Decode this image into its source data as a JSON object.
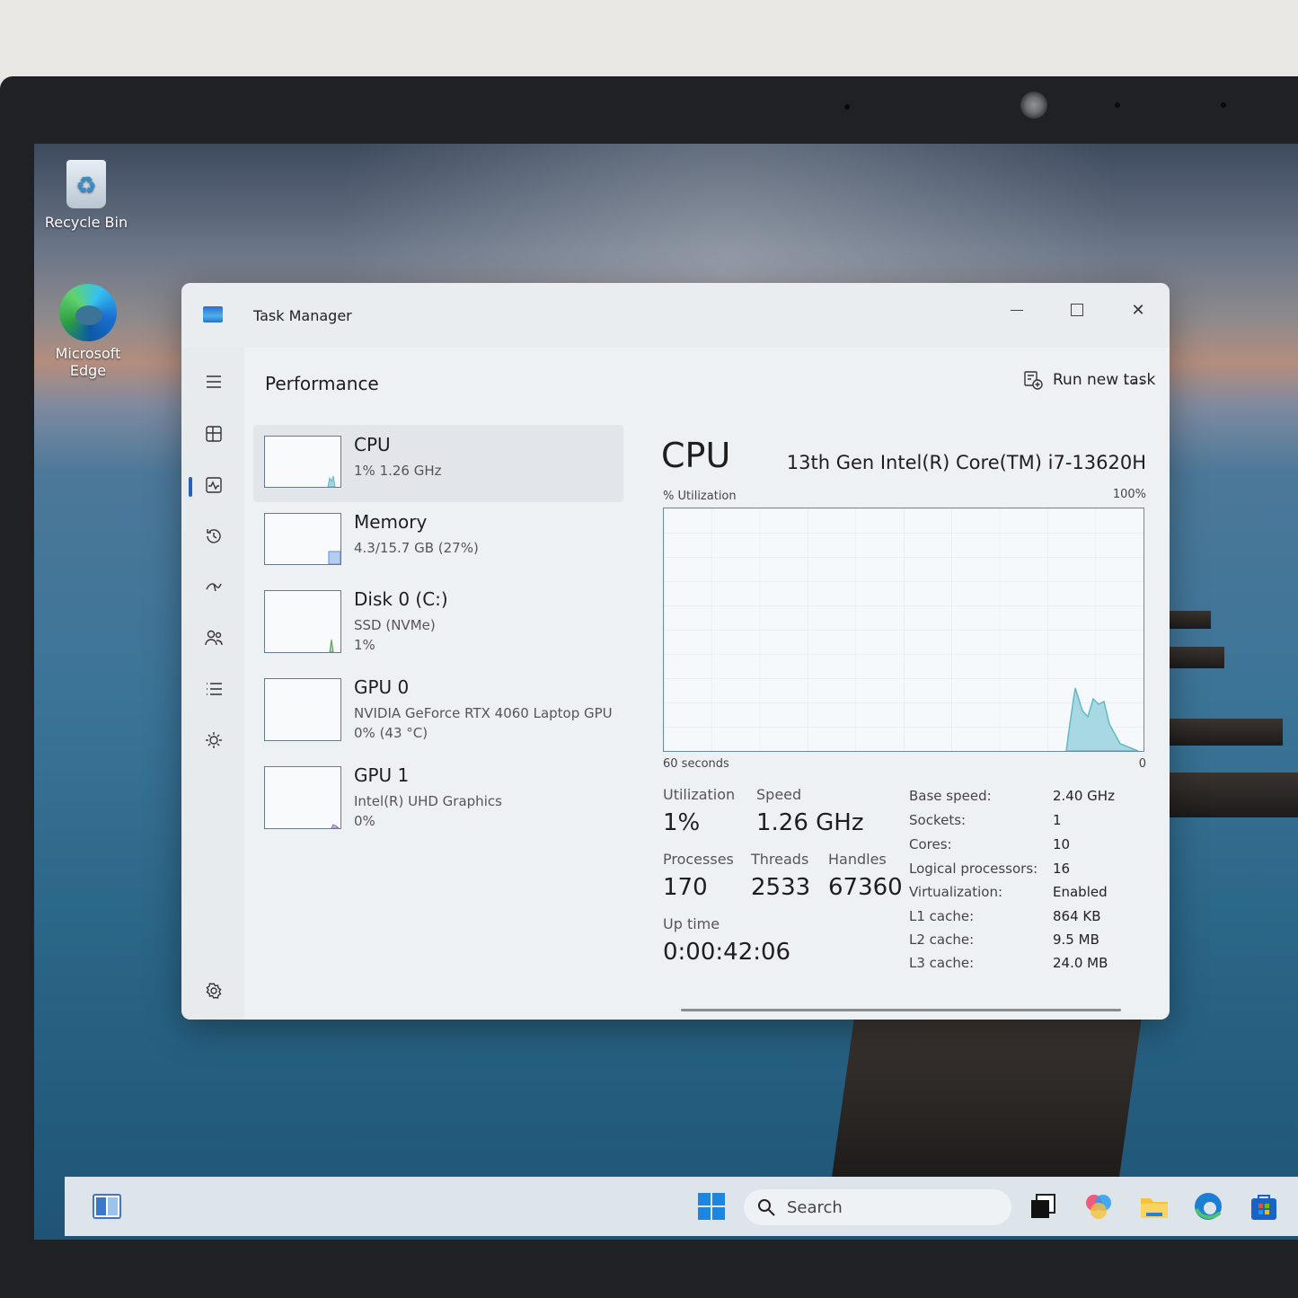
{
  "desktop": {
    "icons": [
      {
        "label": "Recycle Bin"
      },
      {
        "label_line1": "Microsoft",
        "label_line2": "Edge"
      }
    ]
  },
  "window": {
    "title": "Task Manager"
  },
  "command_bar": {
    "page_title": "Performance",
    "run_new_task": "Run new task",
    "more": "..."
  },
  "nav": {
    "items": [
      "hamburger-menu",
      "processes",
      "performance",
      "app-history",
      "startup-apps",
      "users",
      "details",
      "services",
      "settings"
    ],
    "active": "performance"
  },
  "perf_list": [
    {
      "name": "CPU",
      "line1": "1%  1.26 GHz",
      "line2": ""
    },
    {
      "name": "Memory",
      "line1": "4.3/15.7 GB (27%)",
      "line2": ""
    },
    {
      "name": "Disk 0 (C:)",
      "line1": "SSD (NVMe)",
      "line2": "1%"
    },
    {
      "name": "GPU 0",
      "line1": "NVIDIA GeForce RTX 4060 Laptop GPU",
      "line2": "0%  (43 °C)"
    },
    {
      "name": "GPU 1",
      "line1": "Intel(R) UHD Graphics",
      "line2": "0%"
    }
  ],
  "detail": {
    "title": "CPU",
    "model": "13th Gen Intel(R) Core(TM) i7-13620H",
    "y_axis_label": "% Utilization",
    "y_axis_max": "100%",
    "x_axis_label": "60 seconds",
    "x_axis_min": "0",
    "stats": {
      "utilization_label": "Utilization",
      "utilization": "1%",
      "speed_label": "Speed",
      "speed": "1.26 GHz",
      "processes_label": "Processes",
      "processes": "170",
      "threads_label": "Threads",
      "threads": "2533",
      "handles_label": "Handles",
      "handles": "67360",
      "uptime_label": "Up time",
      "uptime": "0:00:42:06"
    },
    "specs": [
      {
        "label": "Base speed:",
        "value": "2.40 GHz"
      },
      {
        "label": "Sockets:",
        "value": "1"
      },
      {
        "label": "Cores:",
        "value": "10"
      },
      {
        "label": "Logical processors:",
        "value": "16"
      },
      {
        "label": "Virtualization:",
        "value": "Enabled"
      },
      {
        "label": "L1 cache:",
        "value": "864 KB"
      },
      {
        "label": "L2 cache:",
        "value": "9.5 MB"
      },
      {
        "label": "L3 cache:",
        "value": "24.0 MB"
      }
    ]
  },
  "taskbar": {
    "search_placeholder": "Search"
  },
  "colors": {
    "accent": "#2a5fb8",
    "cpu_graph": "#62b8c9",
    "memory_graph": "#5b8fd6",
    "disk_graph": "#58a05a",
    "gpu_graph": "#8a62c9"
  }
}
